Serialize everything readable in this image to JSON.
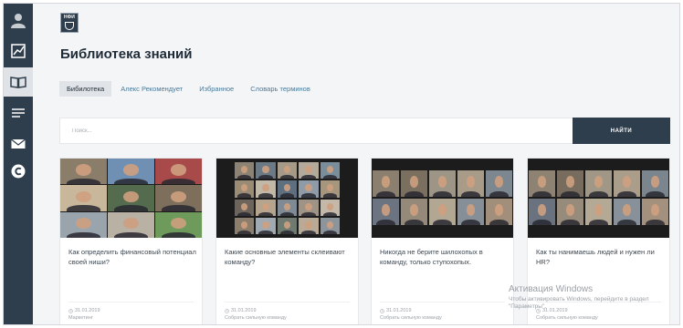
{
  "sidebar": {
    "items": [
      {
        "icon": "user-avatar-icon",
        "active": false
      },
      {
        "icon": "chart-icon",
        "active": false
      },
      {
        "icon": "open-book-icon",
        "active": true
      },
      {
        "icon": "list-icon",
        "active": false
      },
      {
        "icon": "mail-icon",
        "active": false
      },
      {
        "icon": "chat-c-icon",
        "active": false
      }
    ]
  },
  "logo": {
    "text": "НФИ"
  },
  "page": {
    "title": "Библиотека знаний"
  },
  "tabs": [
    {
      "label": "Бибилотека",
      "active": true
    },
    {
      "label": "Алекс Рекомендует",
      "active": false
    },
    {
      "label": "Избранное",
      "active": false
    },
    {
      "label": "Словарь терминов",
      "active": false
    }
  ],
  "search": {
    "placeholder": "Поиск...",
    "button_label": "НАЙТИ"
  },
  "cards": [
    {
      "title": "Как определить финансовый потенциал своей ниши?",
      "date": "31.01.2019",
      "category": "Маркетинг"
    },
    {
      "title": "Какие основные элементы склеивают команду?",
      "date": "31.01.2019",
      "category": "Собрать сильную команду"
    },
    {
      "title": "Никогда не берите шилохопых в команду, только ступохопых.",
      "date": "31.01.2019",
      "category": "Собрать сильную команду"
    },
    {
      "title": "Как ты нанимаешь людей и нужен ли HR?",
      "date": "31.01.2019",
      "category": "Собрать сильную команду"
    }
  ],
  "watermark": {
    "title": "Активация Windows",
    "text": "Чтобы активировать Windows, перейдите в раздел \"Параметры\"."
  },
  "colors": {
    "sidebar": "#2f3e4c",
    "accent_link": "#4a7a98",
    "background": "#f4f5f7"
  }
}
